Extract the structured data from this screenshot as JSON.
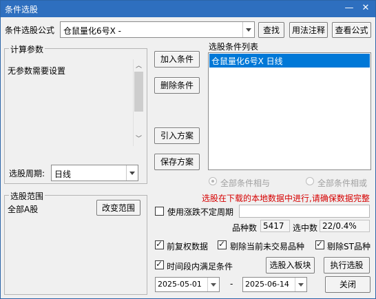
{
  "window": {
    "title": "条件选股",
    "minimize": "—",
    "close": "✕"
  },
  "formula": {
    "label": "条件选股公式",
    "value": "仓鼠量化6号X  -",
    "find_button": "查找",
    "usage_button": "用法注释",
    "view_button": "查看公式"
  },
  "params": {
    "group_title": "计算参数",
    "text": "无参数需要设置",
    "period_label": "选股周期:",
    "period_value": "日线"
  },
  "scope": {
    "group_title": "选股范围",
    "value": "全部A股",
    "change_button": "改变范围"
  },
  "actions": {
    "add": "加入条件",
    "delete": "删除条件",
    "import": "引入方案",
    "save": "保存方案"
  },
  "conditions": {
    "label": "选股条件列表",
    "items": [
      "仓鼠量化6号X  日线"
    ]
  },
  "logic": {
    "and_label": "全部条件相与",
    "or_label": "全部条件相或"
  },
  "notice": "选股在下载的本地数据中进行,请确保数据完整",
  "options": {
    "unfixed_period": "使用涨跌不定周期",
    "variety_label": "品种数",
    "variety_value": "5417",
    "selected_label": "选中数",
    "selected_value": "22/0.4%",
    "prev_adjust": "前复权数据",
    "exclude_untraded": "剔除当前未交易品种",
    "exclude_st": "剔除ST品种",
    "time_range": "时间段内满足条件"
  },
  "dates": {
    "start": "2025-05-01",
    "separator": "-",
    "end": "2025-06-14"
  },
  "buttons": {
    "to_board": "选股入板块",
    "execute": "执行选股",
    "close": "关闭"
  },
  "colors": {
    "title_bar": "#2e6fbf",
    "selection": "#0078d7",
    "notice": "#d60000"
  }
}
